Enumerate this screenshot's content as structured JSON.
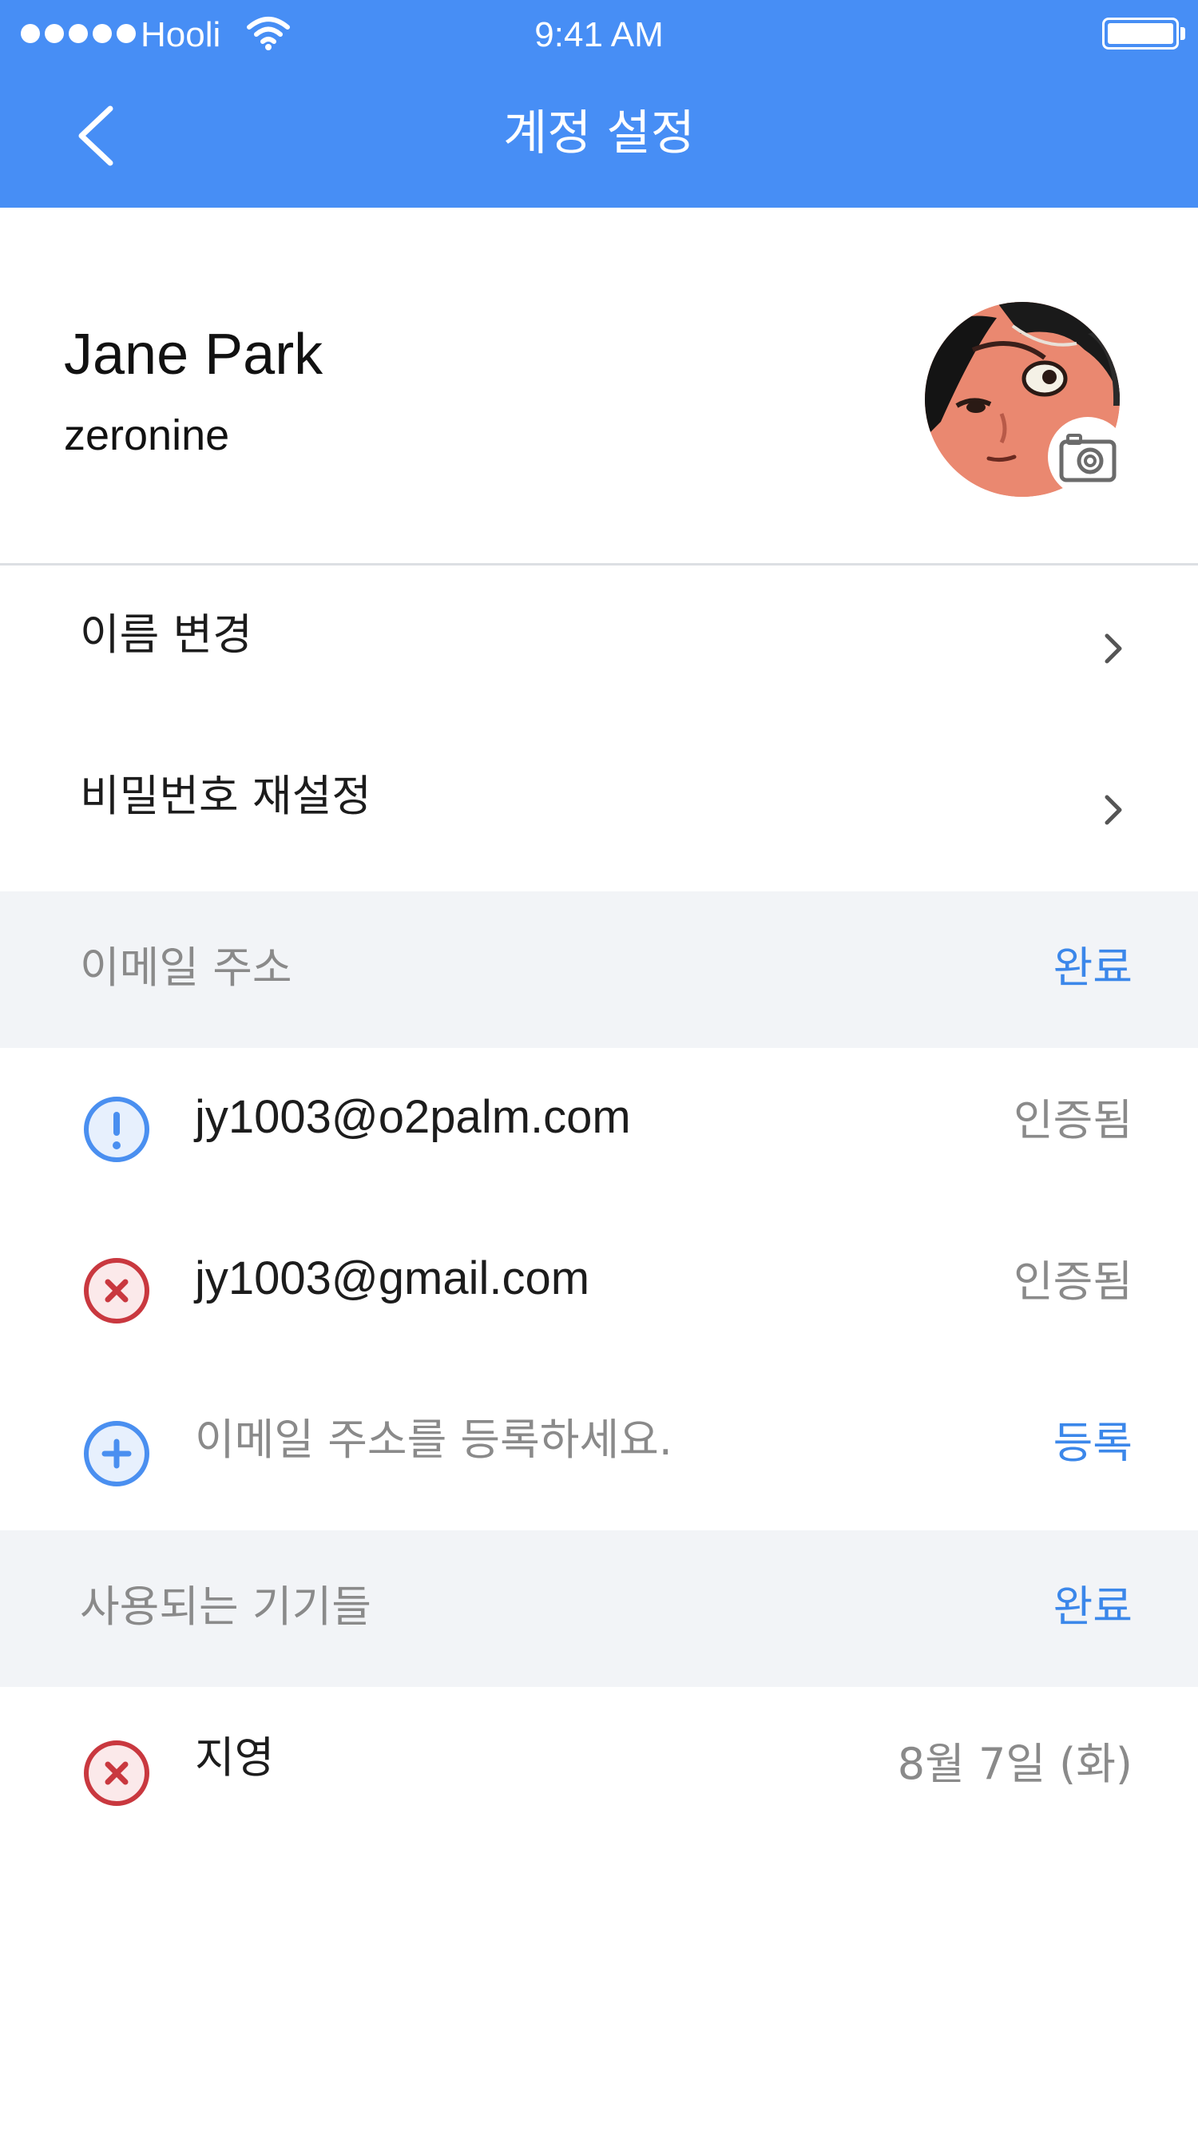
{
  "status_bar": {
    "carrier": "Hooli",
    "time": "9:41 AM"
  },
  "nav": {
    "title": "계정 설정",
    "back_icon": "chevron-left-icon"
  },
  "profile": {
    "name": "Jane Park",
    "username": "zeronine",
    "camera_icon": "camera-icon"
  },
  "menu": {
    "items": [
      {
        "label": "이름 변경"
      },
      {
        "label": "비밀번호 재설정"
      }
    ]
  },
  "email_section": {
    "title": "이메일 주소",
    "action": "완료",
    "entries": [
      {
        "icon": "alert-icon",
        "email": "jy1003@o2palm.com",
        "status": "인증됨"
      },
      {
        "icon": "remove-icon",
        "email": "jy1003@gmail.com",
        "status": "인증됨"
      }
    ],
    "add": {
      "icon": "add-icon",
      "placeholder": "이메일 주소를 등록하세요.",
      "action": "등록"
    }
  },
  "device_section": {
    "title": "사용되는 기기들",
    "action": "완료",
    "devices": [
      {
        "icon": "remove-icon",
        "name": "지영",
        "date": "8월 7일 (화)"
      }
    ]
  },
  "colors": {
    "header": "#478ef5",
    "accent": "#3b87ea",
    "danger": "#c9383f",
    "section_bg": "#f2f4f7",
    "muted_text": "#8a8a8a"
  }
}
